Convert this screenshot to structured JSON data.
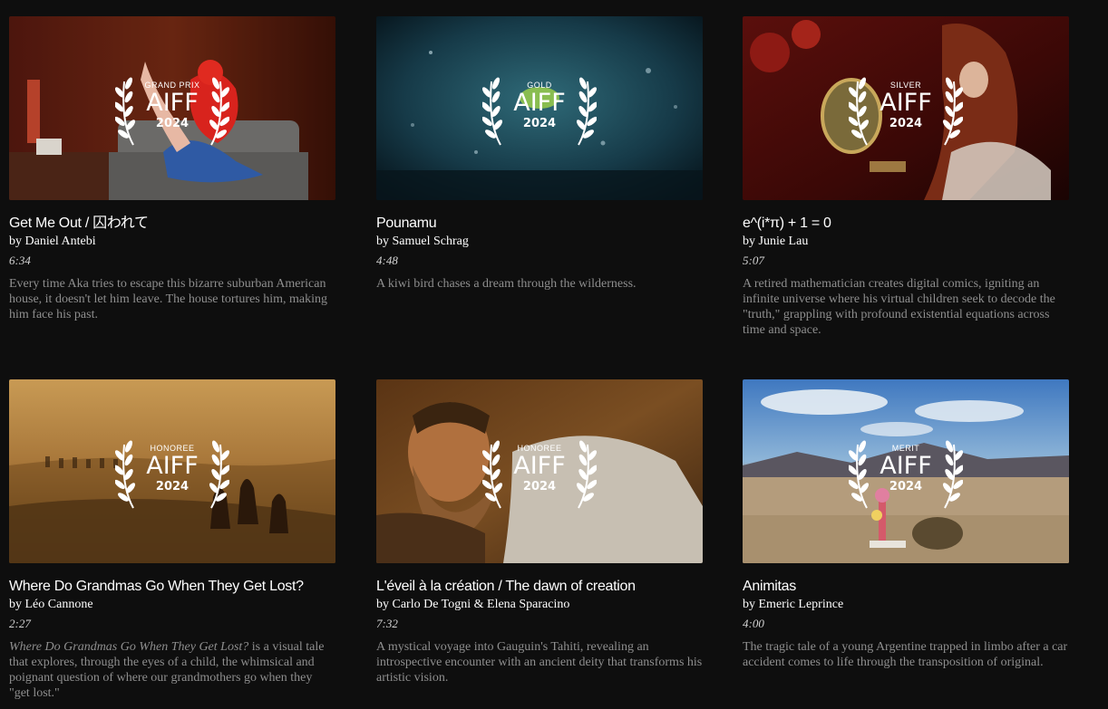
{
  "festival": {
    "name": "AIFF",
    "year": "2024"
  },
  "films": [
    {
      "award": "GRAND PRIX",
      "title": "Get Me Out / 囚われて",
      "author": "by Daniel Antebi",
      "duration": "6:34",
      "description_italic": "",
      "description": "Every time Aka tries to escape this bizarre suburban American house, it doesn't let him leave. The house tortures him, making him face his past."
    },
    {
      "award": "GOLD",
      "title": "Pounamu",
      "author": "by Samuel Schrag",
      "duration": "4:48",
      "description_italic": "",
      "description": "A kiwi bird chases a dream through the wilderness."
    },
    {
      "award": "SILVER",
      "title": "e^(i*π) + 1 = 0",
      "author": "by Junie Lau",
      "duration": "5:07",
      "description_italic": "",
      "description": "A retired mathematician creates digital comics, igniting an infinite universe where his virtual children seek to decode the \"truth,\" grappling with profound existential equations across time and space."
    },
    {
      "award": "HONOREE",
      "title": "Where Do Grandmas Go When They Get Lost?",
      "author": "by Léo Cannone",
      "duration": "2:27",
      "description_italic": "Where Do Grandmas Go When They Get Lost?",
      "description": " is a visual tale that explores, through the eyes of a child, the whimsical and poignant question of where our grandmothers go when they \"get lost.\""
    },
    {
      "award": "HONOREE",
      "title": "L'éveil à la création / The dawn of creation",
      "author": "by Carlo De Togni & Elena Sparacino",
      "duration": "7:32",
      "description_italic": "",
      "description": "A mystical voyage into Gauguin's Tahiti, revealing an introspective encounter with an ancient deity that transforms his artistic vision."
    },
    {
      "award": "MERIT",
      "title": "Animitas",
      "author": "by Emeric Leprince",
      "duration": "4:00",
      "description_italic": "",
      "description": "The tragic tale of a young Argentine trapped in limbo after a car accident comes to life through the transposition of original."
    }
  ]
}
